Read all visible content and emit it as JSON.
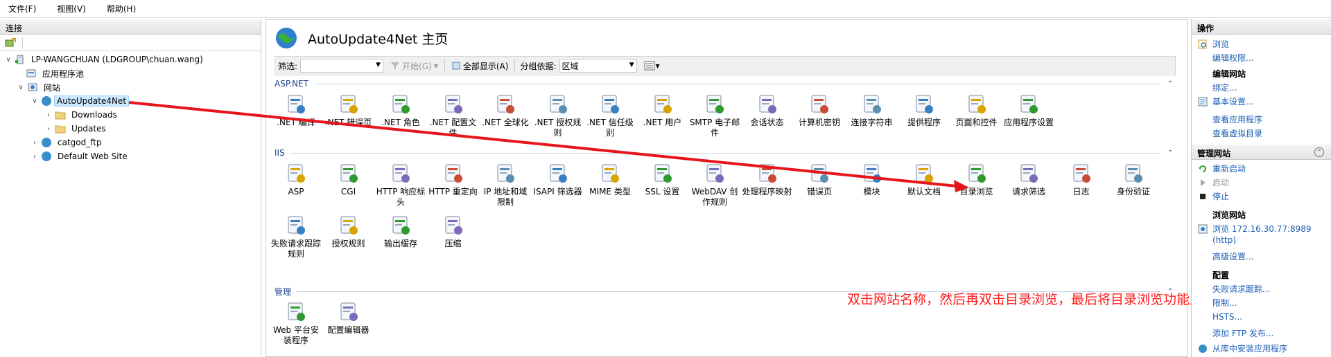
{
  "menu": [
    "文件(F)",
    "视图(V)",
    "帮助(H)"
  ],
  "connections": {
    "header": "连接",
    "tree": [
      {
        "label": "LP-WANGCHUAN (LDGROUP\\chuan.wang)",
        "icon": "server-icon"
      },
      {
        "label": "应用程序池",
        "icon": "app-pool-icon"
      },
      {
        "label": "网站",
        "icon": "sites-folder-icon"
      },
      {
        "label": "AutoUpdate4Net",
        "icon": "globe-icon"
      },
      {
        "label": "Downloads",
        "icon": "folder-icon"
      },
      {
        "label": "Updates",
        "icon": "folder-icon"
      },
      {
        "label": "catgod_ftp",
        "icon": "globe-icon"
      },
      {
        "label": "Default Web Site",
        "icon": "globe-icon"
      }
    ]
  },
  "main": {
    "title": "AutoUpdate4Net 主页",
    "filter": {
      "label": "筛选:",
      "go": "开始(G)",
      "show_all": "全部显示(A)",
      "group_label": "分组依据:",
      "group_value": "区域"
    },
    "groups": [
      {
        "name": "ASP.NET",
        "items": [
          ".NET 编译",
          ".NET 错误页",
          ".NET 角色",
          ".NET 配置文件",
          ".NET 全球化",
          ".NET 授权规则",
          ".NET 信任级别",
          ".NET 用户",
          "SMTP 电子邮件",
          "会话状态",
          "计算机密钥",
          "连接字符串",
          "提供程序",
          "页面和控件",
          "应用程序设置"
        ]
      },
      {
        "name": "IIS",
        "items": [
          "ASP",
          "CGI",
          "HTTP 响应标头",
          "HTTP 重定向",
          "IP 地址和域限制",
          "ISAPI 筛选器",
          "MIME 类型",
          "SSL 设置",
          "WebDAV 创作规则",
          "处理程序映射",
          "错误页",
          "模块",
          "默认文档",
          "目录浏览",
          "请求筛选",
          "日志",
          "身份验证",
          "失败请求跟踪规则",
          "授权规则",
          "输出缓存",
          "压缩"
        ]
      },
      {
        "name": "管理",
        "items": [
          "Web 平台安装程序",
          "配置编辑器"
        ]
      }
    ],
    "annotation": "双击网站名称，然后再双击目录浏览，最后将目录浏览功能启用"
  },
  "actions": {
    "header": "操作",
    "browse": "浏览",
    "edit_permissions": "编辑权限...",
    "edit_site_title": "编辑网站",
    "bindings": "绑定...",
    "basic_settings": "基本设置...",
    "view_apps": "查看应用程序",
    "view_vdirs": "查看虚拟目录",
    "manage_site_title": "管理网站",
    "restart": "重新启动",
    "start": "启动",
    "stop": "停止",
    "browse_site_title": "浏览网站",
    "browse_url": "浏览 172.16.30.77:8989 (http)",
    "advanced": "高级设置...",
    "config_title": "配置",
    "failed_req": "失败请求跟踪...",
    "limits": "限制...",
    "hsts": "HSTS...",
    "add_ftp": "添加 FTP 发布...",
    "install_app": "从库中安装应用程序"
  },
  "colors": {
    "link": "#1a5cb4",
    "group_header": "#1e3e8c",
    "annotation": "#ff1a1a",
    "selection": "#cce8ff"
  }
}
